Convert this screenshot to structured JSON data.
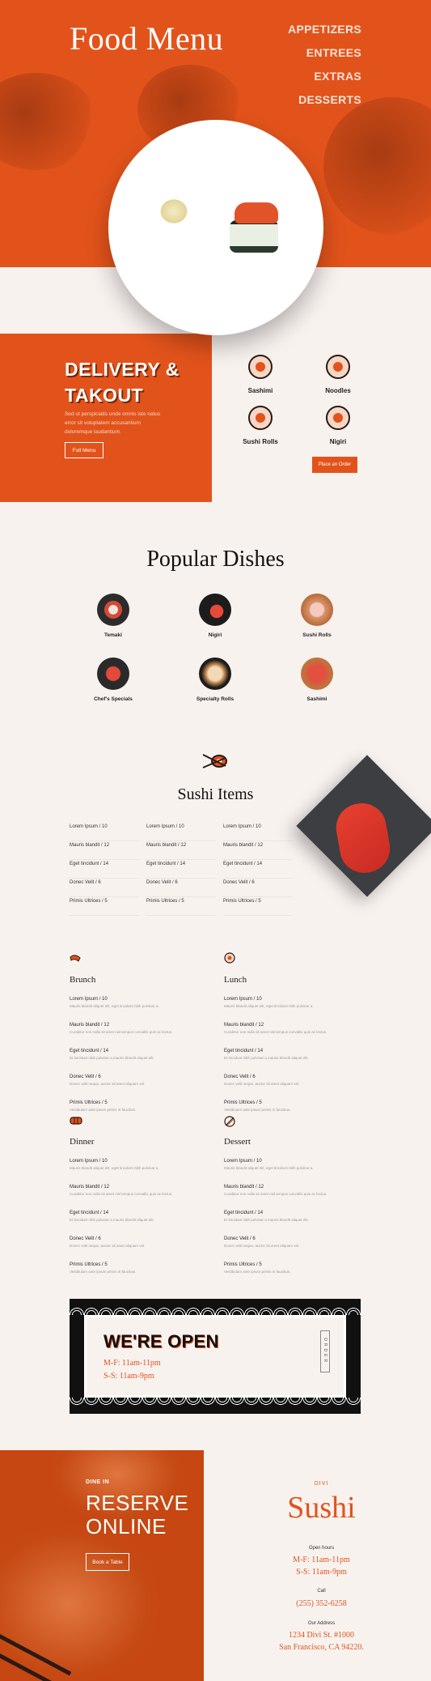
{
  "hero": {
    "title": "Food Menu",
    "nav": [
      "APPETIZERS",
      "ENTREES",
      "EXTRAS",
      "DESSERTS"
    ]
  },
  "delivery": {
    "title_line1": "DELIVERY &",
    "title_line2": "TAKOUT",
    "text": "Sed ut perspiciatis unde omnis iste natus error sit voluptatem accusantium doloremque laudantium.",
    "button": "Full Menu"
  },
  "categories": [
    {
      "label": "Sashimi",
      "icon": "fish-icon"
    },
    {
      "label": "Noodles",
      "icon": "noodles-icon"
    },
    {
      "label": "Sushi Rolls",
      "icon": "sushi-roll-icon"
    },
    {
      "label": "Nigiri",
      "icon": "nigiri-icon"
    }
  ],
  "order_button": "Place an Order",
  "popular": {
    "title": "Popular Dishes",
    "dishes": [
      "Temaki",
      "Nigiri",
      "Sushi Rolls",
      "Chef's Specials",
      "Specialty Rolls",
      "Sashimi"
    ]
  },
  "sushi_items": {
    "title": "Sushi Items",
    "columns": [
      [
        "Lorem Ipsum / 10",
        "Mauris blandit / 12",
        "Eget tincidunt / 14",
        "Donec Velit / 6",
        "Primis Ultrices / 5"
      ],
      [
        "Lorem Ipsum / 10",
        "Mauris blandit / 12",
        "Eget tincidunt / 14",
        "Donec Velit / 6",
        "Primis Ultrices / 5"
      ],
      [
        "Lorem Ipsum / 10",
        "Mauris blandit / 12",
        "Eget tincidunt / 14",
        "Donec Velit / 6",
        "Primis Ultrices / 5"
      ]
    ]
  },
  "menus": [
    {
      "title": "Brunch",
      "icon": "shrimp-icon",
      "items": [
        {
          "name": "Lorem Ipsum / 10",
          "desc": "Mauris blandit aliquet elit, eget tincidunt nibh pulvinar a."
        },
        {
          "name": "Mauris blandit / 12",
          "desc": "Curabitur non nulla sit amet nisl tempus convallis quis ac lectus."
        },
        {
          "name": "Eget tincidunt / 14",
          "desc": "Et tincidunt nibh pulvinar a mauris blandit aliquet elit."
        },
        {
          "name": "Donec Velit / 6",
          "desc": "Donec velit neque, auctor sit amet aliquam vel."
        },
        {
          "name": "Primis Ultrices / 5",
          "desc": "Vestibulum ante ipsum primis in faucibus."
        }
      ]
    },
    {
      "title": "Lunch",
      "icon": "bowl-icon",
      "items": [
        {
          "name": "Lorem Ipsum / 10",
          "desc": "Mauris blandit aliquet elit, eget tincidunt nibh pulvinar a."
        },
        {
          "name": "Mauris blandit / 12",
          "desc": "Curabitur non nulla sit amet nisl tempus convallis quis ac lectus."
        },
        {
          "name": "Eget tincidunt / 14",
          "desc": "Et tincidunt nibh pulvinar a mauris blandit aliquet elit."
        },
        {
          "name": "Donec Velit / 6",
          "desc": "Donec velit neque, auctor sit amet aliquam vel."
        },
        {
          "name": "Primis Ultrices / 5",
          "desc": "Vestibulum ante ipsum primis in faucibus."
        }
      ]
    },
    {
      "title": "Dinner",
      "icon": "sushi-roll-icon",
      "items": [
        {
          "name": "Lorem Ipsum / 10",
          "desc": "Mauris blandit aliquet elit, eget tincidunt nibh pulvinar a."
        },
        {
          "name": "Mauris blandit / 12",
          "desc": "Curabitur non nulla sit amet nisl tempus convallis quis ac lectus."
        },
        {
          "name": "Eget tincidunt / 14",
          "desc": "Et tincidunt nibh pulvinar a mauris blandit aliquet elit."
        },
        {
          "name": "Donec Velit / 6",
          "desc": "Donec velit neque, auctor sit amet aliquam vel."
        },
        {
          "name": "Primis Ultrices / 5",
          "desc": "Vestibulum ante ipsum primis in faucibus."
        }
      ]
    },
    {
      "title": "Dessert",
      "icon": "chopsticks-icon",
      "items": [
        {
          "name": "Lorem Ipsum / 10",
          "desc": "Mauris blandit aliquet elit, eget tincidunt nibh pulvinar a."
        },
        {
          "name": "Mauris blandit / 12",
          "desc": "Curabitur non nulla sit amet nisl tempus convallis quis ac lectus."
        },
        {
          "name": "Eget tincidunt / 14",
          "desc": "Et tincidunt nibh pulvinar a mauris blandit aliquet elit."
        },
        {
          "name": "Donec Velit / 6",
          "desc": "Donec velit neque, auctor sit amet aliquam vel."
        },
        {
          "name": "Primis Ultrices / 5",
          "desc": "Vestibulum ante ipsum primis in faucibus."
        }
      ]
    }
  ],
  "open": {
    "title": "WE'RE OPEN",
    "weekday": "M-F: 11am-11pm",
    "weekend": "S-S: 11am-9pm",
    "order_tag": "ORDER"
  },
  "reserve": {
    "kicker": "DINE IN",
    "title_line1": "RESERVE",
    "title_line2": "ONLINE",
    "button": "Book a Table"
  },
  "info": {
    "kicker": "DIVI",
    "brand": "Sushi",
    "hours_label": "Open hours",
    "hours_weekday": "M-F: 11am-11pm",
    "hours_weekend": "S-S: 11am-9pm",
    "call_label": "Call",
    "phone": "(255) 352-6258",
    "address_label": "Our Address",
    "address_line1": "1234 Divi St. #1000",
    "address_line2": "San Francisco, CA 94220."
  },
  "colors": {
    "accent": "#e2531b",
    "background": "#f8f2ef",
    "dark": "#111111"
  }
}
